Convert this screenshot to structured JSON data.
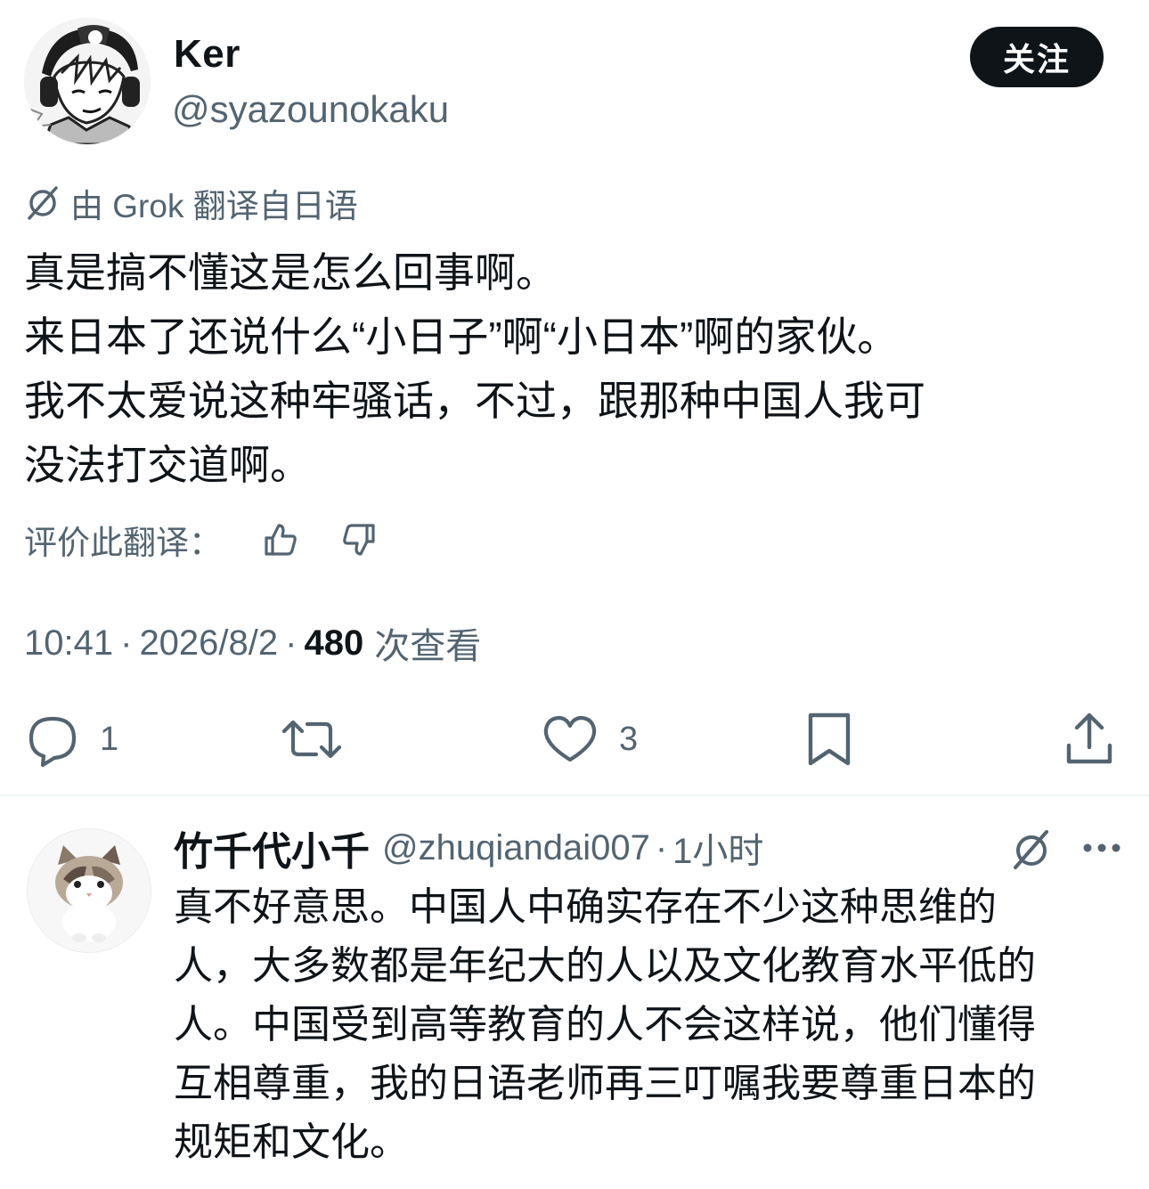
{
  "post": {
    "author": {
      "name": "Ker",
      "handle": "@syazounokaku",
      "avatar_icon": "manga-character-avatar"
    },
    "follow_label": "关注",
    "translation_note": "由 Grok 翻译自日语",
    "body_lines": [
      "真是搞不懂这是怎么回事啊。",
      "来日本了还说什么“小日子”啊“小日本”啊的家伙。",
      "我不太爱说这种牢骚话，不过，跟那种中国人我可",
      "没法打交道啊。"
    ],
    "rate_label": "评价此翻译：",
    "meta": {
      "time": "10:41",
      "date": "2026/8/2",
      "views_count": "480",
      "views_label": "次查看",
      "separator": "·"
    },
    "actions": {
      "reply_count": "1",
      "retweet_count": "",
      "like_count": "3"
    }
  },
  "reply": {
    "name": "竹千代小千",
    "handle": "@zhuqiandai007",
    "time": "1小时",
    "separator": "·",
    "avatar_icon": "cat-avatar",
    "body_lines": [
      "真不好意思。中国人中确实存在不少这种思维的",
      "人，大多数都是年纪大的人以及文化教育水平低的",
      "人。中国受到高等教育的人不会这样说，他们懂得",
      "互相尊重，我的日语老师再三叮嘱我要尊重日本的",
      "规矩和文化。"
    ]
  },
  "colors": {
    "text_primary": "#0f1419",
    "text_secondary": "#536471",
    "button_bg": "#0f1419",
    "divider": "#eff3f4"
  }
}
